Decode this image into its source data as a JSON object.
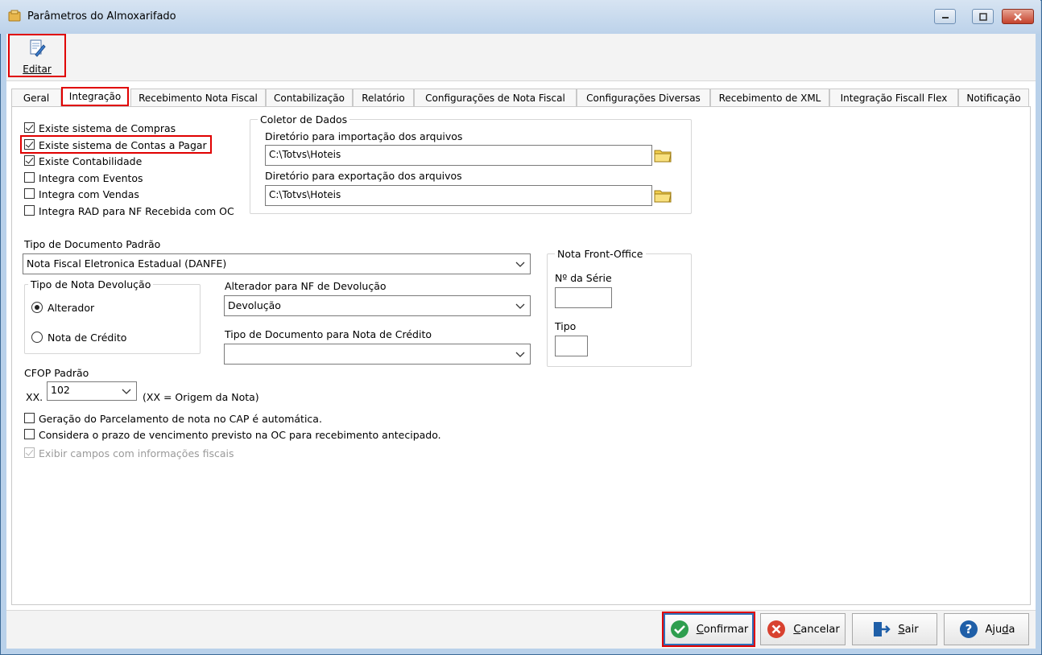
{
  "window": {
    "title": "Parâmetros do Almoxarifado"
  },
  "toolbar": {
    "edit_label": "Editar"
  },
  "tabs": [
    {
      "label": "Geral"
    },
    {
      "label": "Integração"
    },
    {
      "label": "Recebimento Nota Fiscal"
    },
    {
      "label": "Contabilização"
    },
    {
      "label": "Relatório"
    },
    {
      "label": "Configurações de Nota Fiscal"
    },
    {
      "label": "Configurações Diversas"
    },
    {
      "label": "Recebimento de XML"
    },
    {
      "label": "Integração Fiscall Flex"
    },
    {
      "label": "Notificação"
    }
  ],
  "integration": {
    "checkboxes": [
      {
        "label": "Existe sistema de Compras",
        "checked": true
      },
      {
        "label": "Existe sistema de Contas a Pagar",
        "checked": true
      },
      {
        "label": "Existe Contabilidade",
        "checked": true
      },
      {
        "label": "Integra com Eventos",
        "checked": false
      },
      {
        "label": "Integra com Vendas",
        "checked": false
      },
      {
        "label": "Integra RAD para NF Recebida com OC",
        "checked": false
      }
    ]
  },
  "coletor": {
    "title": "Coletor de Dados",
    "import_label": "Diretório para importação dos arquivos",
    "import_value": "C:\\Totvs\\Hoteis",
    "export_label": "Diretório para exportação dos arquivos",
    "export_value": "C:\\Totvs\\Hoteis"
  },
  "tipo_documento": {
    "label": "Tipo de Documento Padrão",
    "value": "Nota Fiscal Eletronica Estadual (DANFE)"
  },
  "nota_devolucao": {
    "title": "Tipo de Nota Devolução",
    "options": [
      {
        "label": "Alterador",
        "selected": true
      },
      {
        "label": "Nota de Crédito",
        "selected": false
      }
    ]
  },
  "alterador": {
    "label": "Alterador para NF de Devolução",
    "value": "Devolução"
  },
  "tipo_doc_credito": {
    "label": "Tipo de Documento para Nota de Crédito",
    "value": ""
  },
  "front_office": {
    "title": "Nota Front-Office",
    "serie_label": "Nº da Série",
    "serie_value": "",
    "tipo_label": "Tipo",
    "tipo_value": ""
  },
  "cfop": {
    "label": "CFOP Padrão",
    "prefix": "XX.",
    "value": "102",
    "note": "(XX = Origem da Nota)"
  },
  "options": [
    {
      "label": "Geração do Parcelamento de nota no CAP é automática.",
      "checked": false,
      "disabled": false
    },
    {
      "label": "Considera o prazo de vencimento previsto na OC para recebimento antecipado.",
      "checked": false,
      "disabled": false
    },
    {
      "label": "Exibir campos com informações fiscais",
      "checked": true,
      "disabled": true
    }
  ],
  "buttons": {
    "confirm_prefix": "C",
    "confirm_rest": "onfirmar",
    "cancel_prefix": "C",
    "cancel_rest": "ancelar",
    "exit_prefix": "S",
    "exit_rest": "air",
    "help_first": "Aju",
    "help_underlined": "d",
    "help_last": "a"
  },
  "colors": {
    "highlight": "#e00000",
    "confirm_green": "#2e9e4f",
    "cancel_red": "#d8412f",
    "help_blue": "#1f5fa8"
  }
}
